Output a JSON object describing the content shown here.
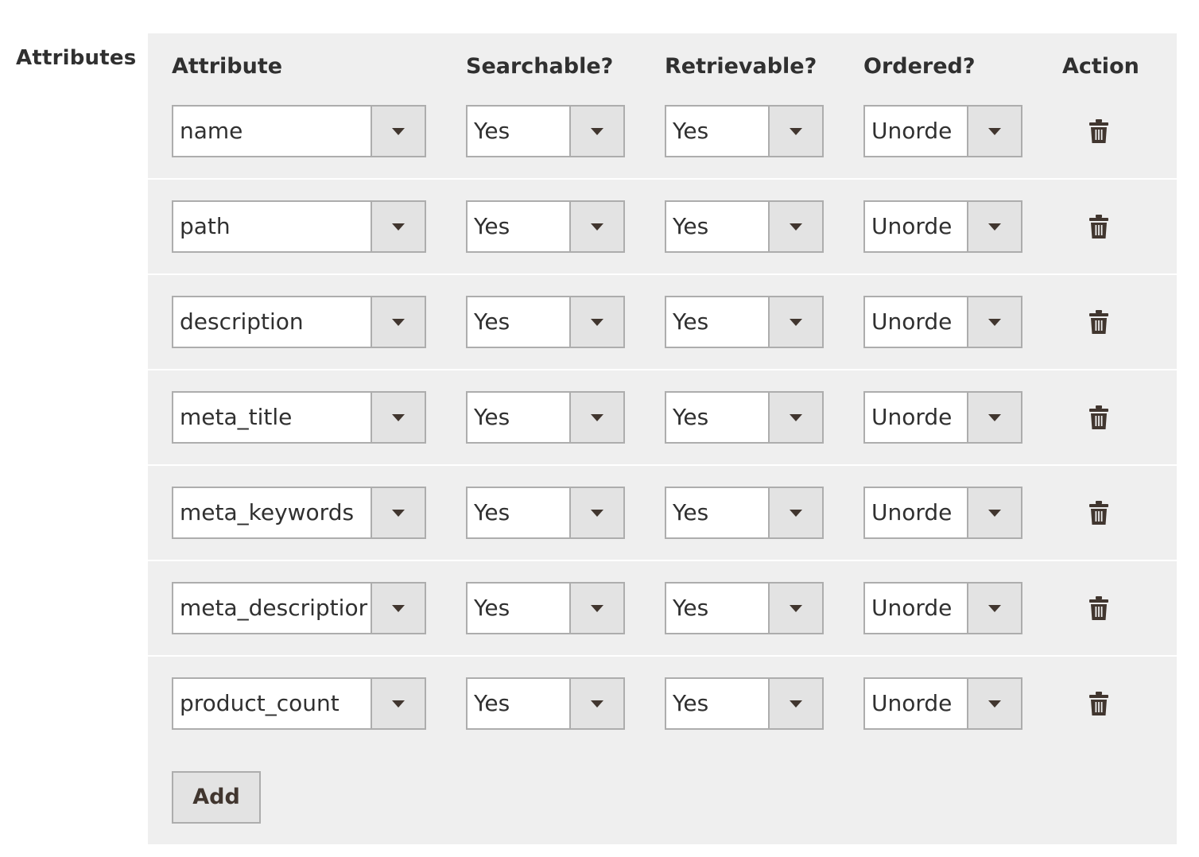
{
  "field_label": "Attributes",
  "columns": {
    "attribute": "Attribute",
    "searchable": "Searchable?",
    "retrievable": "Retrievable?",
    "ordered": "Ordered?",
    "action": "Action"
  },
  "rows": [
    {
      "attribute": "name",
      "searchable": "Yes",
      "retrievable": "Yes",
      "ordered": "Unorde"
    },
    {
      "attribute": "path",
      "searchable": "Yes",
      "retrievable": "Yes",
      "ordered": "Unorde"
    },
    {
      "attribute": "description",
      "searchable": "Yes",
      "retrievable": "Yes",
      "ordered": "Unorde"
    },
    {
      "attribute": "meta_title",
      "searchable": "Yes",
      "retrievable": "Yes",
      "ordered": "Unorde"
    },
    {
      "attribute": "meta_keywords",
      "searchable": "Yes",
      "retrievable": "Yes",
      "ordered": "Unorde"
    },
    {
      "attribute": "meta_descriptior",
      "searchable": "Yes",
      "retrievable": "Yes",
      "ordered": "Unorde"
    },
    {
      "attribute": "product_count",
      "searchable": "Yes",
      "retrievable": "Yes",
      "ordered": "Unorde"
    }
  ],
  "add_label": "Add",
  "icons": {
    "dropdown": "caret-down-icon",
    "delete": "trash-icon"
  },
  "colors": {
    "panel_bg": "#efefef",
    "border": "#adadad",
    "button_bg": "#e3e3e3",
    "text": "#303030",
    "icon": "#41362f"
  }
}
